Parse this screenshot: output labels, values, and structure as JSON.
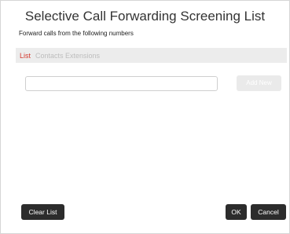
{
  "dialog": {
    "title": "Selective Call Forwarding Screening List",
    "subtitle": "Forward calls from the following numbers"
  },
  "tabs": [
    {
      "label": "List",
      "active": true
    },
    {
      "label": "Contacts",
      "active": false
    },
    {
      "label": "Extensions",
      "active": false
    }
  ],
  "number_input": {
    "value": "",
    "placeholder": ""
  },
  "buttons": {
    "add_new": "Add New",
    "clear_list": "Clear List",
    "ok": "OK",
    "cancel": "Cancel"
  },
  "colors": {
    "active_tab": "#d33a2f",
    "inactive_tab": "#bdbdbd",
    "tab_bar_bg": "#ececec",
    "dark_button": "#2c2c2c",
    "disabled_button": "#eaeaea"
  }
}
